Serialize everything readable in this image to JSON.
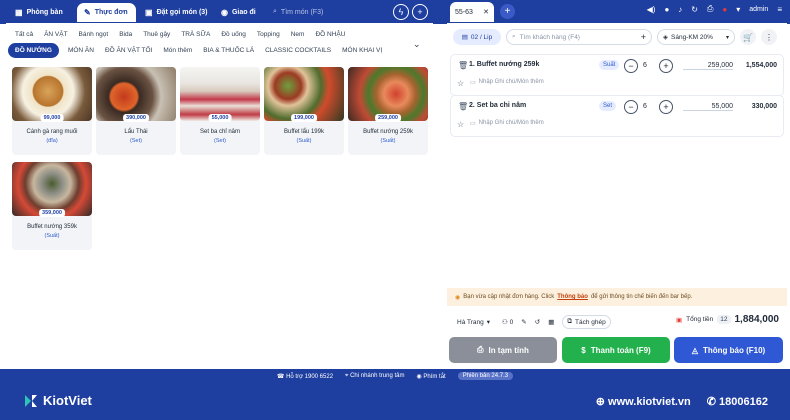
{
  "topbar": {
    "tabs": [
      {
        "label": "Phòng bàn",
        "icon": "grid-icon"
      },
      {
        "label": "Thực đơn",
        "icon": "menu-book-icon"
      },
      {
        "label": "Đặt gọi món (3)",
        "icon": "order-icon"
      },
      {
        "label": "Giao đi",
        "icon": "delivery-icon"
      }
    ],
    "search_placeholder": "Tìm món (F3)",
    "order_tab_label": "55-63",
    "user": "admin"
  },
  "categories_row1": [
    "Tất cả",
    "ĂN VẶT",
    "Bánh ngọt",
    "Bida",
    "Thuê gậy",
    "TRÀ SỮA",
    "Đồ uống",
    "Topping",
    "Nem",
    "ĐỒ NHẬU"
  ],
  "categories_row2": [
    "ĐỒ NƯỚNG",
    "MÓN ĂN",
    "ĐỒ ĂN VẶT TỐI",
    "Món thêm",
    "BIA & THUỐC LÁ",
    "CLASSIC COCKTAILS",
    "MÓN KHAI VỊ"
  ],
  "menu_items": [
    {
      "name": "Cánh gà rang muối",
      "price": "99,000",
      "unit": "(đĩa)"
    },
    {
      "name": "Lẩu Thái",
      "price": "390,000",
      "unit": "(Set)"
    },
    {
      "name": "Set ba chỉ nâm",
      "price": "55,000",
      "unit": "(Set)"
    },
    {
      "name": "Buffet lẩu 199k",
      "price": "199,000",
      "unit": "(Suất)"
    },
    {
      "name": "Buffet nướng 259k",
      "price": "259,000",
      "unit": "(Suất)"
    },
    {
      "name": "Buffet nướng 359k",
      "price": "359,000",
      "unit": "(Suất)"
    }
  ],
  "order": {
    "table": "02 / Lip",
    "customer_placeholder": "Tìm khách hàng (F4)",
    "promo": "Sáng-KM 20%",
    "lines": [
      {
        "name": "1. Buffet nướng 259k",
        "unit": "Suất",
        "qty": "6",
        "price": "259,000",
        "total": "1,554,000",
        "note": "Nhập Ghi chú/Món thêm"
      },
      {
        "name": "2. Set ba chỉ nâm",
        "unit": "Set",
        "qty": "6",
        "price": "55,000",
        "total": "330,000",
        "note": "Nhập Ghi chú/Món thêm"
      }
    ],
    "notice_prefix": "Bạn vừa cập nhật đơn hàng. Click",
    "notice_link": "Thông báo",
    "notice_suffix": "để gửi thông tin chế biến đến bar bếp.",
    "staff": "Hà Trang",
    "guests": "0",
    "split_label": "Tách ghép",
    "total_label": "Tổng tiền",
    "total_count": "12",
    "total_amount": "1,884,000",
    "btn_print": "In tạm tính",
    "btn_pay": "Thanh toán (F9)",
    "btn_notify": "Thông báo (F10)"
  },
  "status": {
    "support": "Hỗ trợ 1900 6522",
    "branch": "Chi nhánh trung tâm",
    "shortcuts": "Phím tắt",
    "version": "Phiên bản 24.7.3"
  },
  "footer": {
    "brand": "KiotViet",
    "website": "www.kiotviet.vn",
    "phone": "18006162"
  },
  "colors": {
    "brand_blue": "#1f3fa0",
    "pay_green": "#22b14c",
    "notify_blue": "#2f58d4",
    "print_gray": "#8a8f99"
  }
}
